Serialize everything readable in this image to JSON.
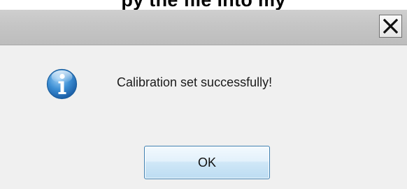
{
  "top_strip": {
    "partial_text": "py the file into my"
  },
  "titlebar": {
    "title": ""
  },
  "dialog": {
    "icon": "information-icon",
    "message": "Calibration set successfully!",
    "ok_label": "OK"
  },
  "close_button": {
    "icon": "close-icon"
  },
  "colors": {
    "titlebar": "#c6c6c6",
    "content_background": "#f0f0f0",
    "button_border": "#3c7fb1",
    "button_fill": "#dcecf9",
    "info_icon_blue": "#2f7cc3"
  }
}
